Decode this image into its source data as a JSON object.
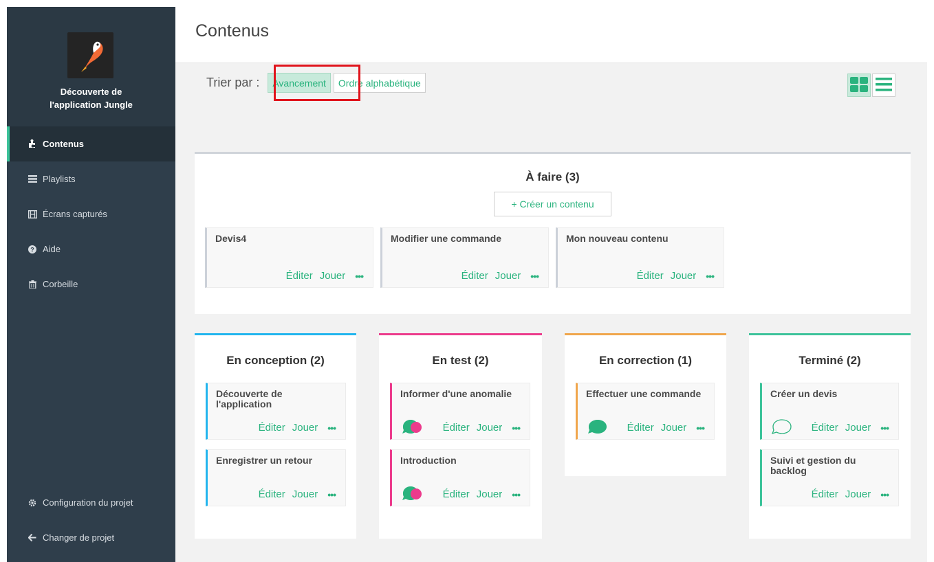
{
  "sidebar": {
    "project_name_line1": "Découverte de",
    "project_name_line2": "l'application Jungle",
    "items": [
      {
        "label": "Contenus",
        "icon": "puzzle-icon"
      },
      {
        "label": "Playlists",
        "icon": "list-icon"
      },
      {
        "label": "Écrans capturés",
        "icon": "film-icon"
      },
      {
        "label": "Aide",
        "icon": "question-icon"
      },
      {
        "label": "Corbeille",
        "icon": "trash-icon"
      }
    ],
    "bottom_items": [
      {
        "label": "Configuration du projet",
        "icon": "gear-icon"
      },
      {
        "label": "Changer de projet",
        "icon": "arrow-left-icon"
      }
    ]
  },
  "header": {
    "title": "Contenus"
  },
  "sort": {
    "label": "Trier par :",
    "options": [
      "Avancement",
      "Ordre alphabétique"
    ],
    "selected": "Avancement"
  },
  "columns": {
    "todo": {
      "title": "À faire (3)",
      "create_label": "+ Créer un contenu",
      "cards": [
        {
          "title": "Devis4"
        },
        {
          "title": "Modifier une commande"
        },
        {
          "title": "Mon nouveau contenu"
        }
      ]
    },
    "conception": {
      "title": "En conception (2)",
      "color": "#22b5ee",
      "cards": [
        {
          "title": "Découverte de l'application"
        },
        {
          "title": "Enregistrer un retour"
        }
      ]
    },
    "test": {
      "title": "En test (2)",
      "color": "#ec3b8c",
      "cards": [
        {
          "title": "Informer d'une anomalie",
          "comment": "teal-pink"
        },
        {
          "title": "Introduction",
          "comment": "teal-pink"
        }
      ]
    },
    "correction": {
      "title": "En correction (1)",
      "color": "#f0a64c",
      "cards": [
        {
          "title": "Effectuer une commande",
          "comment": "teal"
        }
      ]
    },
    "done": {
      "title": "Terminé (2)",
      "color": "#3cc39a",
      "cards": [
        {
          "title": "Créer un devis",
          "comment": "outline"
        },
        {
          "title": "Suivi et gestion du backlog"
        }
      ]
    }
  },
  "card_actions": {
    "edit": "Éditer",
    "play": "Jouer",
    "more": "•••"
  },
  "colors": {
    "accent": "#2ab37e",
    "sidebar_bg": "#2f3e4b",
    "highlight": "#e0141c"
  }
}
